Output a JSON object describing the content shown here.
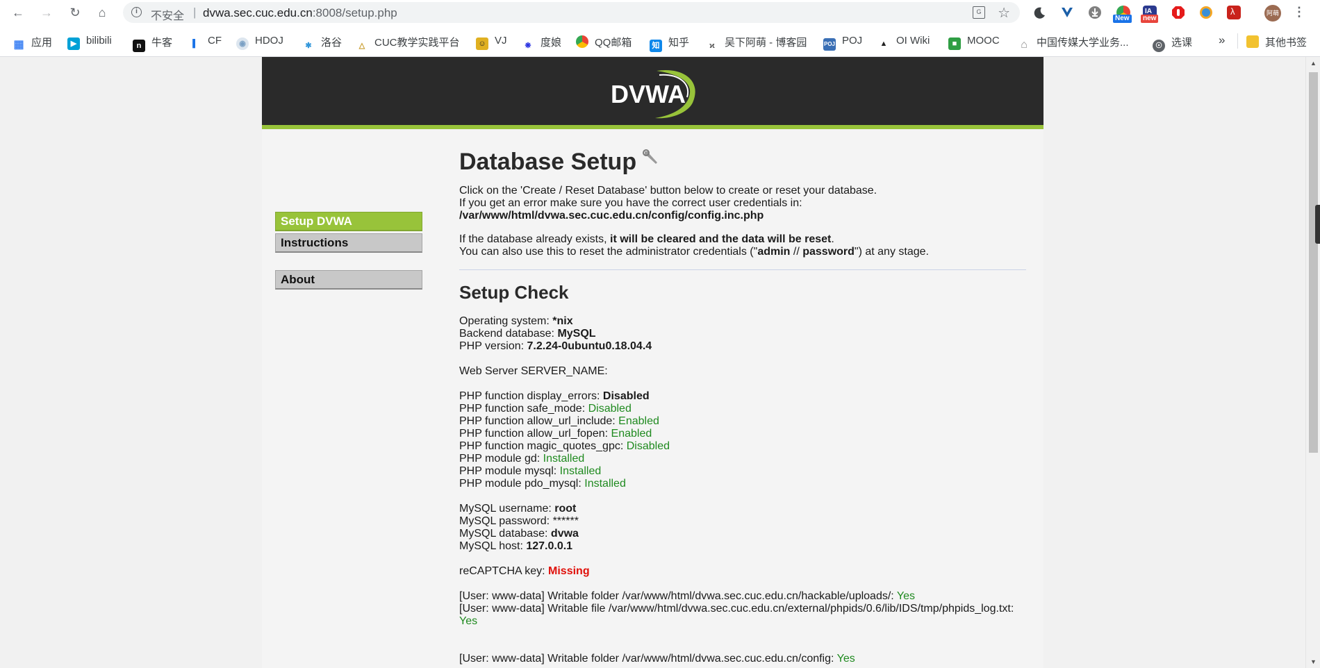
{
  "browser": {
    "security_label": "不安全",
    "url_host": "dvwa.sec.cuc.edu.cn",
    "url_rest": ":8008/setup.php",
    "avatar_label": "阿萌",
    "ext_badge_1": "New",
    "ext_badge_2": "new"
  },
  "bookmarks": [
    {
      "label": "应用",
      "icon": "apps-grid-icon",
      "color": "#4285f4"
    },
    {
      "label": "bilibili",
      "icon": "bilibili-icon",
      "color": "#00a1d6"
    },
    {
      "label": "牛客",
      "icon": "nowcoder-icon",
      "color": "#111111"
    },
    {
      "label": "CF",
      "icon": "codeforces-icon",
      "color": "#1a73e8"
    },
    {
      "label": "HDOJ",
      "icon": "hdoj-icon",
      "color": "#7aa0c4"
    },
    {
      "label": "洛谷",
      "icon": "luogu-icon",
      "color": "#3498db"
    },
    {
      "label": "CUC教学实践平台",
      "icon": "cuc-icon",
      "color": "#c89b2a"
    },
    {
      "label": "VJ",
      "icon": "vjudge-icon",
      "color": "#e0b021"
    },
    {
      "label": "度娘",
      "icon": "baidu-icon",
      "color": "#2932e1"
    },
    {
      "label": "QQ邮箱",
      "icon": "qqmail-icon",
      "color": "#e8a33d"
    },
    {
      "label": "知乎",
      "icon": "zhihu-icon",
      "color": "#0f88eb"
    },
    {
      "label": "吴下阿萌 - 博客园",
      "icon": "cnblogs-icon",
      "color": "#555555"
    },
    {
      "label": "POJ",
      "icon": "poj-icon",
      "color": "#3a6fb5"
    },
    {
      "label": "OI Wiki",
      "icon": "oiwiki-icon",
      "color": "#222222"
    },
    {
      "label": "MOOC",
      "icon": "mooc-icon",
      "color": "#2f9e44"
    },
    {
      "label": "中国传媒大学业务...",
      "icon": "home-icon",
      "color": "#8a8a8a"
    },
    {
      "label": "选课",
      "icon": "globe-icon",
      "color": "#5f6368"
    },
    {
      "label": "其他书签",
      "icon": "folder-icon",
      "color": "#f2c230"
    }
  ],
  "brand": {
    "logo_text": "DVWA",
    "accent": "#98c33a",
    "header_bg": "#2a2a2a"
  },
  "menu": [
    {
      "label": "Setup DVWA",
      "active": true
    },
    {
      "label": "Instructions",
      "active": false
    },
    {
      "label": "About",
      "active": false
    }
  ],
  "page": {
    "title": "Database Setup",
    "intro_1": "Click on the 'Create / Reset Database' button below to create or reset your database.",
    "intro_2": "If you get an error make sure you have the correct user credentials in:",
    "config_path": "/var/www/html/dvwa.sec.cuc.edu.cn/config/config.inc.php",
    "warn_1_pre": "If the database already exists, ",
    "warn_1_bold": "it will be cleared and the data will be reset",
    "warn_1_post": ".",
    "warn_2_pre": "You can also use this to reset the administrator credentials (\"",
    "warn_2_user": "admin",
    "warn_2_mid": " // ",
    "warn_2_pass": "password",
    "warn_2_post": "\") at any stage.",
    "check_title": "Setup Check"
  },
  "checks": {
    "os_label": "Operating system: ",
    "os_value": "*nix",
    "db_label": "Backend database: ",
    "db_value": "MySQL",
    "php_label": "PHP version: ",
    "php_value": "7.2.24-0ubuntu0.18.04.4",
    "server_name": "Web Server SERVER_NAME:",
    "display_errors_label": "PHP function display_errors: ",
    "display_errors_value": "Disabled",
    "safe_mode_label": "PHP function safe_mode: ",
    "safe_mode_value": "Disabled",
    "allow_url_include_label": "PHP function allow_url_include: ",
    "allow_url_include_value": "Enabled",
    "allow_url_fopen_label": "PHP function allow_url_fopen: ",
    "allow_url_fopen_value": "Enabled",
    "magic_quotes_label": "PHP function magic_quotes_gpc: ",
    "magic_quotes_value": "Disabled",
    "gd_label": "PHP module gd: ",
    "gd_value": "Installed",
    "mysql_label": "PHP module mysql: ",
    "mysql_value": "Installed",
    "pdo_label": "PHP module pdo_mysql: ",
    "pdo_value": "Installed",
    "mysql_user_label": "MySQL username: ",
    "mysql_user_value": "root",
    "mysql_pass_label": "MySQL password: ",
    "mysql_pass_value": "******",
    "mysql_db_label": "MySQL database: ",
    "mysql_db_value": "dvwa",
    "mysql_host_label": "MySQL host: ",
    "mysql_host_value": "127.0.0.1",
    "recaptcha_label": "reCAPTCHA key: ",
    "recaptcha_value": "Missing",
    "writable_1_label": "[User: www-data] Writable folder /var/www/html/dvwa.sec.cuc.edu.cn/hackable/uploads/: ",
    "writable_1_value": "Yes",
    "writable_2_label": "[User: www-data] Writable file /var/www/html/dvwa.sec.cuc.edu.cn/external/phpids/0.6/lib/IDS/tmp/phpids_log.txt:",
    "writable_2_value": "Yes",
    "writable_3_label": "[User: www-data] Writable folder /var/www/html/dvwa.sec.cuc.edu.cn/config: ",
    "writable_3_value": "Yes"
  },
  "colors": {
    "status_ok": "#1f8a1f",
    "status_error": "#e0110b"
  }
}
